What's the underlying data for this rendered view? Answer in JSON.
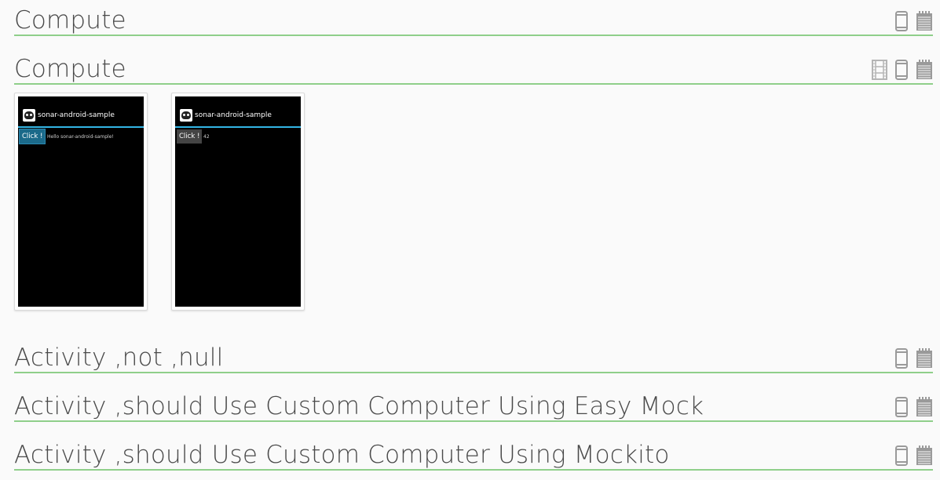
{
  "sections": [
    {
      "title": "Compute",
      "icons": [
        "device-icon",
        "log-icon"
      ]
    },
    {
      "title": "Compute",
      "icons": [
        "film-icon",
        "device-icon",
        "log-icon"
      ]
    },
    {
      "title": "Activity ,not ,null",
      "icons": [
        "device-icon",
        "log-icon"
      ]
    },
    {
      "title": "Activity ,should Use Custom Computer Using Easy Mock",
      "icons": [
        "device-icon",
        "log-icon"
      ]
    },
    {
      "title": "Activity ,should Use Custom Computer Using Mockito",
      "icons": [
        "device-icon",
        "log-icon"
      ]
    }
  ],
  "screenshots": [
    {
      "app_title": "sonar-android-sample",
      "button_label": "Click !",
      "message": "Hello sonar-android-sample!",
      "button_focused": true
    },
    {
      "app_title": "sonar-android-sample",
      "button_label": "Click !",
      "message": "42",
      "button_focused": false
    }
  ],
  "colors": {
    "rule": "#8fcf8a",
    "title": "#4a4a4a",
    "icon": "#9a9a9a",
    "actionbar_accent": "#33b5e5"
  }
}
